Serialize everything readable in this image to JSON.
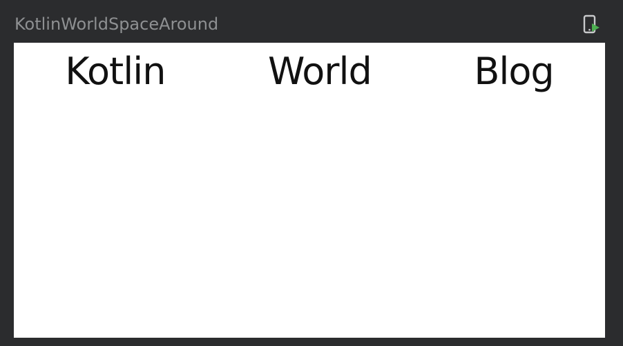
{
  "header": {
    "title": "KotlinWorldSpaceAround",
    "action_icon": "run-on-device-icon",
    "action_icon_colors": {
      "device": "#c9cacc",
      "play": "#4caf50"
    }
  },
  "device": {
    "background": "#ffffff",
    "row": {
      "texts": [
        "Kotlin",
        "World",
        "Blog"
      ]
    }
  }
}
